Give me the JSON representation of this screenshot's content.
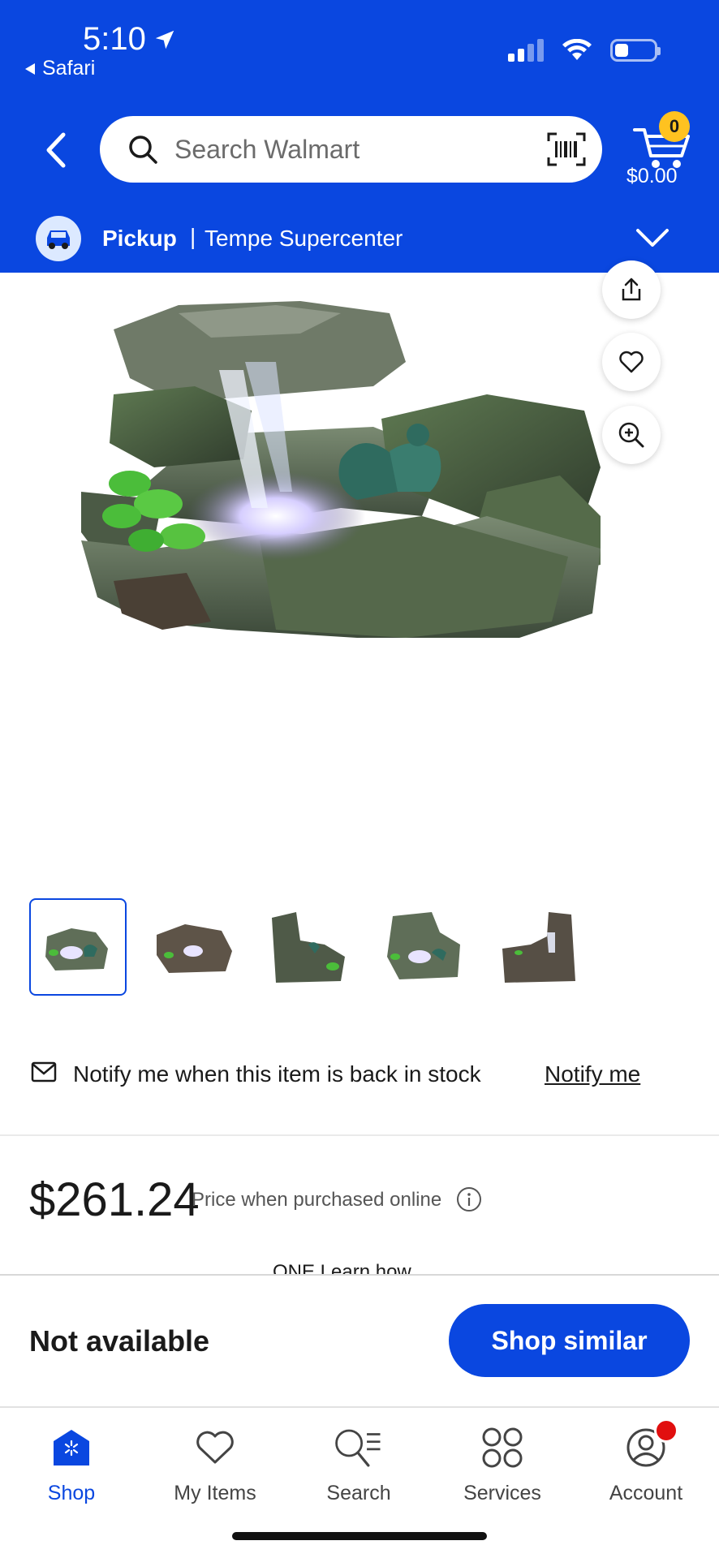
{
  "status_bar": {
    "time": "5:10",
    "back_app": "Safari"
  },
  "header": {
    "search_placeholder": "Search Walmart",
    "cart_count": "0",
    "cart_total": "$0.00",
    "pickup_label": "Pickup",
    "pickup_separator": "|",
    "store_name": "Tempe Supercenter"
  },
  "product": {
    "thumbnail_count": 5,
    "notify_text": "Notify me when this item is back in stock",
    "notify_link": "Notify me",
    "price": "$261.24",
    "price_note": "Price when purchased online",
    "partial_text": "ONE  Learn how"
  },
  "sticky_bar": {
    "availability": "Not available",
    "action_label": "Shop similar"
  },
  "tabs": [
    {
      "label": "Shop",
      "icon": "shop-icon"
    },
    {
      "label": "My Items",
      "icon": "heart-icon"
    },
    {
      "label": "Search",
      "icon": "search-list-icon"
    },
    {
      "label": "Services",
      "icon": "services-icon"
    },
    {
      "label": "Account",
      "icon": "account-icon"
    }
  ],
  "colors": {
    "brand_blue": "#0a47e0",
    "spark_yellow": "#ffc220",
    "notification_red": "#e10f0f"
  }
}
